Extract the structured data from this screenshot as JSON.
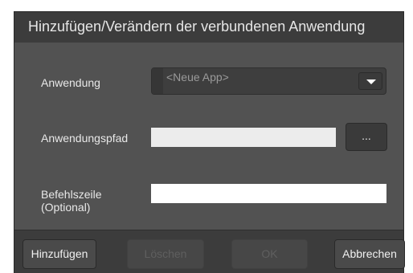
{
  "dialog": {
    "title": "Hinzufügen/Verändern der verbundenen Anwendung"
  },
  "form": {
    "application_label": "Anwendung",
    "application_value": "<Neue App>",
    "path_label": "Anwendungspfad",
    "path_value": "",
    "browse_label": "...",
    "command_label_line1": "Befehlszeile",
    "command_label_line2": "(Optional)",
    "command_value": ""
  },
  "buttons": {
    "add": "Hinzufügen",
    "delete": "Löschen",
    "ok": "OK",
    "cancel": "Abbrechen"
  },
  "icons": {
    "combo_arrow": "chevron-down-icon"
  },
  "colors": {
    "titlebar": "#3c3c3c",
    "body": "#525252",
    "footer": "#3c3c3c",
    "text": "#e8e8e8",
    "disabled_text": "#5f5f5f"
  }
}
